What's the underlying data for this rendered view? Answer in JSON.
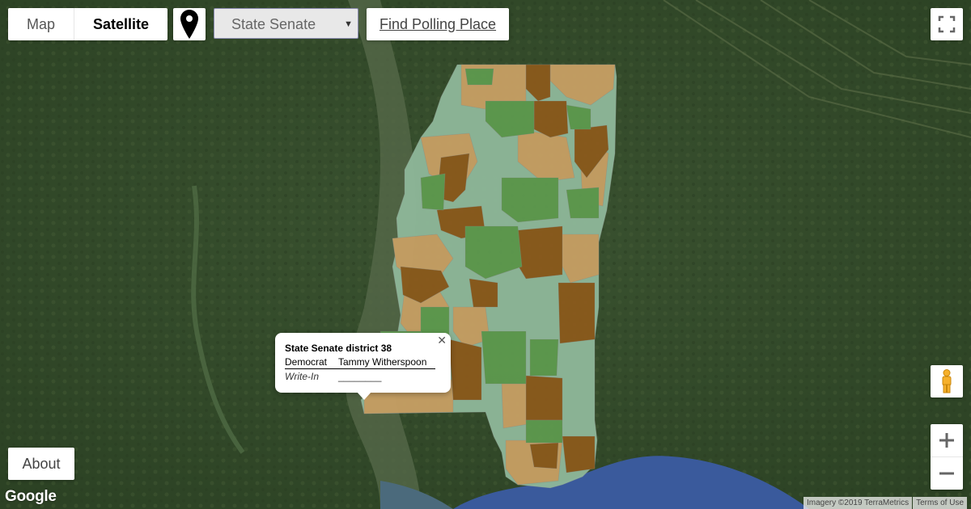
{
  "map_type": {
    "map_label": "Map",
    "satellite_label": "Satellite",
    "selected": "Satellite"
  },
  "layer_select": {
    "value": "State Senate"
  },
  "find_polling_label": "Find Polling Place",
  "about_label": "About",
  "info_window": {
    "title": "State Senate district 38",
    "rows": [
      {
        "party": "Democrat",
        "candidate": "Tammy Witherspoon"
      },
      {
        "party": "Write-In",
        "candidate": "________"
      }
    ]
  },
  "attribution": {
    "imagery": "Imagery ©2019 TerraMetrics",
    "terms": "Terms of Use"
  },
  "logo_text": "Google",
  "icons": [
    "location-pin-icon",
    "caret-down-icon",
    "fullscreen-icon",
    "pegman-icon",
    "zoom-in-icon",
    "zoom-out-icon",
    "close-icon"
  ],
  "district_colors": {
    "light_green": "#8fb89a",
    "green": "#5e9a4e",
    "tan": "#c8a064",
    "brown": "#8b5a1c",
    "water": "#3a5a9c",
    "forest": "#324a28"
  }
}
